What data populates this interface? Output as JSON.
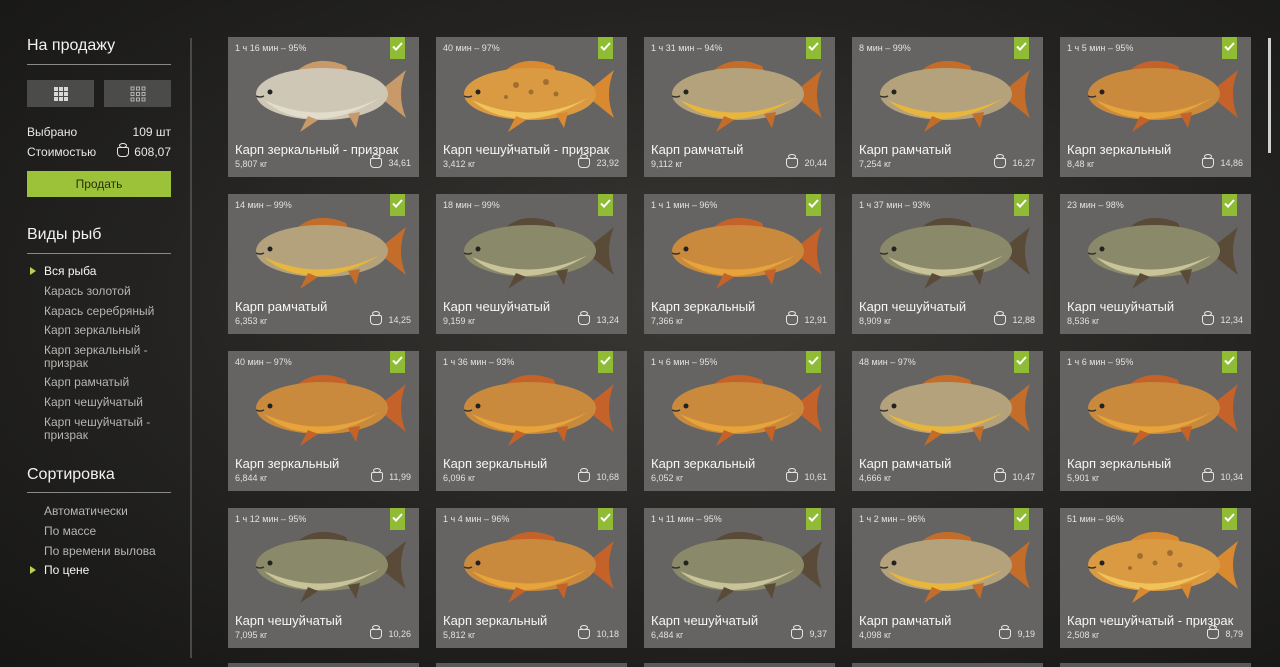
{
  "sale": {
    "title": "На продажу",
    "selected_label": "Выбрано",
    "selected_value": "109 шт",
    "cost_label": "Стоимостью",
    "cost_value": "608,07",
    "sell_button": "Продать",
    "view_icons": [
      "grid-3x3-icon",
      "grid-4x4-icon"
    ]
  },
  "species": {
    "title": "Виды рыб",
    "items": [
      {
        "label": "Вся рыба",
        "active": true
      },
      {
        "label": "Карась золотой",
        "active": false
      },
      {
        "label": "Карась серебряный",
        "active": false
      },
      {
        "label": "Карп зеркальный",
        "active": false
      },
      {
        "label": "Карп зеркальный - призрак",
        "active": false
      },
      {
        "label": "Карп рамчатый",
        "active": false
      },
      {
        "label": "Карп чешуйчатый",
        "active": false
      },
      {
        "label": "Карп чешуйчатый - призрак",
        "active": false
      }
    ]
  },
  "sorting": {
    "title": "Сортировка",
    "items": [
      {
        "label": "Автоматически",
        "active": false
      },
      {
        "label": "По массе",
        "active": false
      },
      {
        "label": "По времени вылова",
        "active": false
      },
      {
        "label": "По цене",
        "active": true
      }
    ]
  },
  "colors": {
    "accent": "#9cc23a",
    "card_bg": "#656463",
    "sidebar_bg": "#1c1c1b"
  },
  "fish": [
    {
      "time": "1 ч 16 мин – 95%",
      "name": "Карп зеркальный - призрак",
      "weight": "5,807 кг",
      "price": "34,61",
      "type": "ghost-mirror"
    },
    {
      "time": "40 мин – 97%",
      "name": "Карп чешуйчатый - призрак",
      "weight": "3,412 кг",
      "price": "23,92",
      "type": "ghost-scaly"
    },
    {
      "time": "1 ч 31 мин – 94%",
      "name": "Карп рамчатый",
      "weight": "9,112 кг",
      "price": "20,44",
      "type": "frame"
    },
    {
      "time": "8 мин – 99%",
      "name": "Карп рамчатый",
      "weight": "7,254 кг",
      "price": "16,27",
      "type": "frame"
    },
    {
      "time": "1 ч 5 мин – 95%",
      "name": "Карп зеркальный",
      "weight": "8,48 кг",
      "price": "14,86",
      "type": "mirror"
    },
    {
      "time": "14 мин – 99%",
      "name": "Карп рамчатый",
      "weight": "6,353 кг",
      "price": "14,25",
      "type": "frame"
    },
    {
      "time": "18 мин – 99%",
      "name": "Карп чешуйчатый",
      "weight": "9,159 кг",
      "price": "13,24",
      "type": "scaly"
    },
    {
      "time": "1 ч 1 мин – 96%",
      "name": "Карп зеркальный",
      "weight": "7,366 кг",
      "price": "12,91",
      "type": "mirror"
    },
    {
      "time": "1 ч 37 мин – 93%",
      "name": "Карп чешуйчатый",
      "weight": "8,909 кг",
      "price": "12,88",
      "type": "scaly"
    },
    {
      "time": "23 мин – 98%",
      "name": "Карп чешуйчатый",
      "weight": "8,536 кг",
      "price": "12,34",
      "type": "scaly"
    },
    {
      "time": "40 мин – 97%",
      "name": "Карп зеркальный",
      "weight": "6,844 кг",
      "price": "11,99",
      "type": "mirror"
    },
    {
      "time": "1 ч 36 мин – 93%",
      "name": "Карп зеркальный",
      "weight": "6,096 кг",
      "price": "10,68",
      "type": "mirror"
    },
    {
      "time": "1 ч 6 мин – 95%",
      "name": "Карп зеркальный",
      "weight": "6,052 кг",
      "price": "10,61",
      "type": "mirror"
    },
    {
      "time": "48 мин – 97%",
      "name": "Карп рамчатый",
      "weight": "4,666 кг",
      "price": "10,47",
      "type": "frame"
    },
    {
      "time": "1 ч 6 мин – 95%",
      "name": "Карп зеркальный",
      "weight": "5,901 кг",
      "price": "10,34",
      "type": "mirror"
    },
    {
      "time": "1 ч 12 мин – 95%",
      "name": "Карп чешуйчатый",
      "weight": "7,095 кг",
      "price": "10,26",
      "type": "scaly"
    },
    {
      "time": "1 ч 4 мин – 96%",
      "name": "Карп зеркальный",
      "weight": "5,812 кг",
      "price": "10,18",
      "type": "mirror"
    },
    {
      "time": "1 ч 11 мин – 95%",
      "name": "Карп чешуйчатый",
      "weight": "6,484 кг",
      "price": "9,37",
      "type": "scaly"
    },
    {
      "time": "1 ч 2 мин – 96%",
      "name": "Карп рамчатый",
      "weight": "4,098 кг",
      "price": "9,19",
      "type": "frame"
    },
    {
      "time": "51 мин – 96%",
      "name": "Карп чешуйчатый - призрак",
      "weight": "2,508 кг",
      "price": "8,79",
      "type": "ghost-scaly"
    }
  ]
}
